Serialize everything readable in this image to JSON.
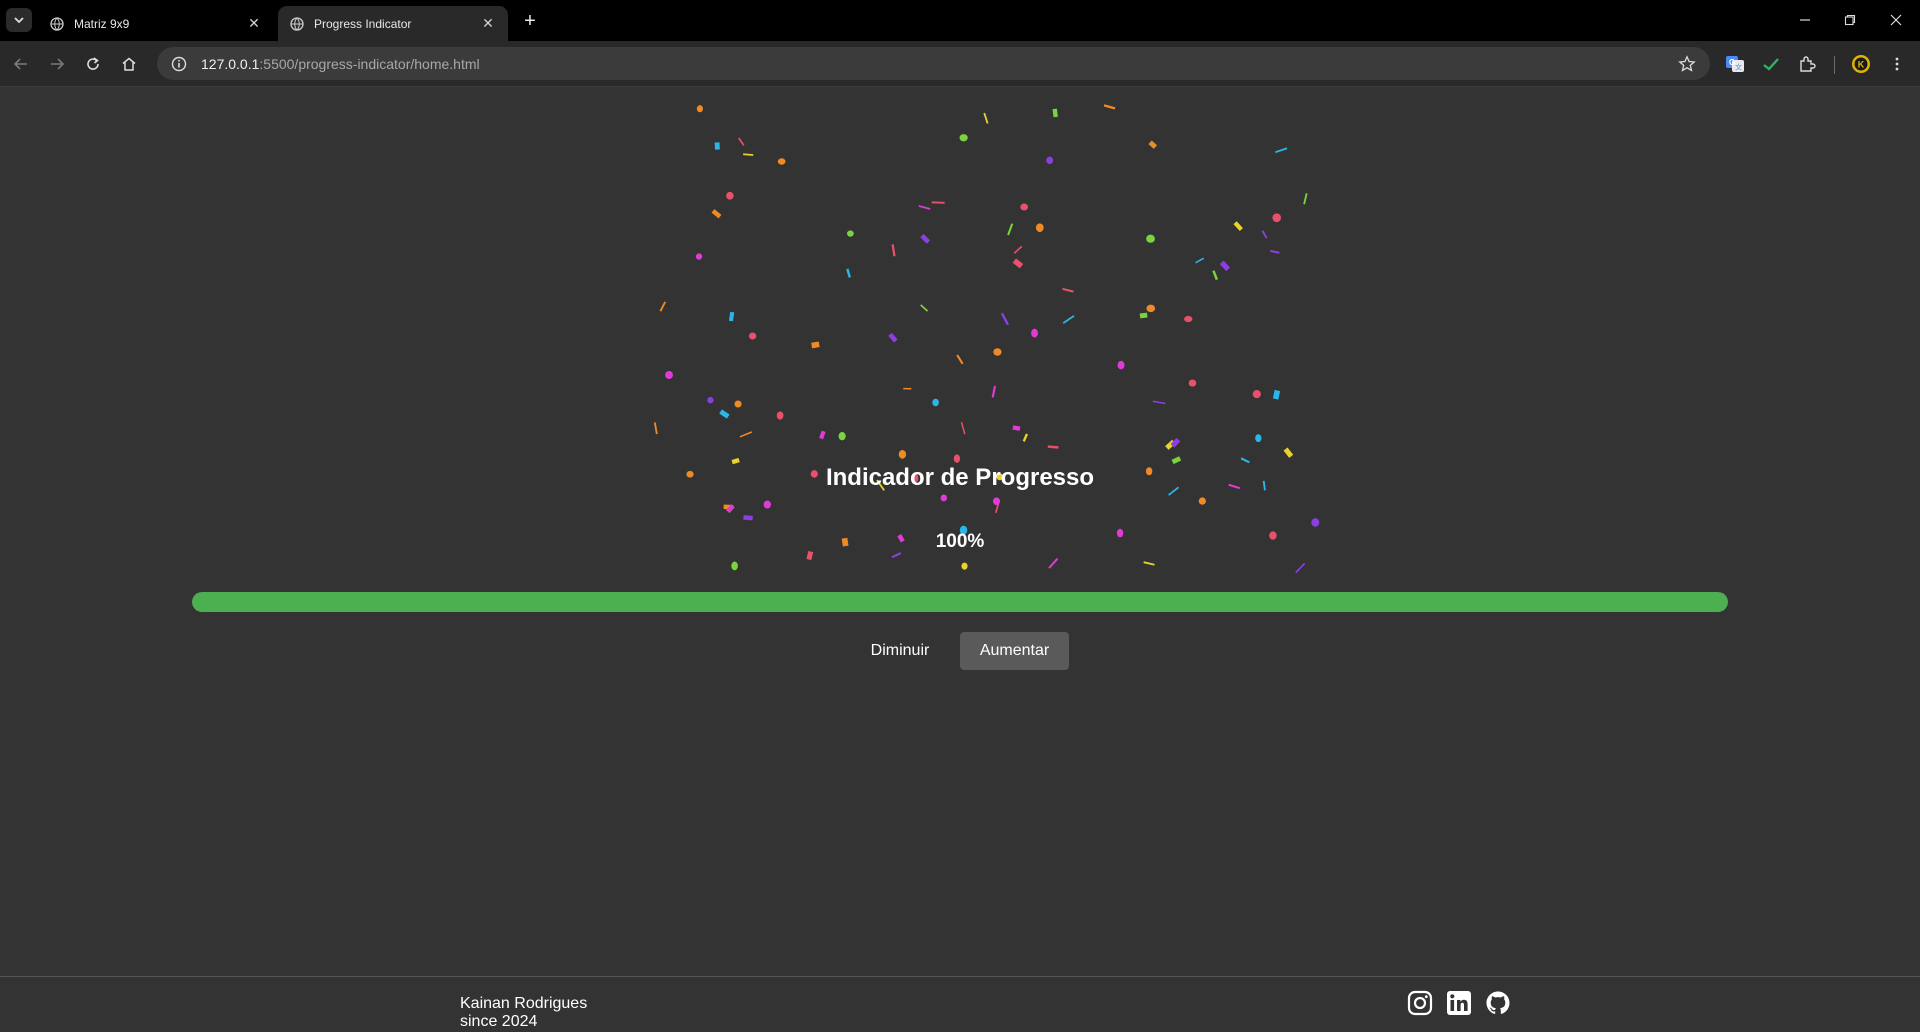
{
  "browser": {
    "tabs": [
      {
        "title": "Matriz 9x9",
        "active": false
      },
      {
        "title": "Progress Indicator",
        "active": true
      }
    ],
    "url_host": "127.0.0.1",
    "url_path": ":5500/progress-indicator/home.html"
  },
  "main": {
    "heading": "Indicador de Progresso",
    "percent_label": "100%",
    "progress": 1.0,
    "decrease_label": "Diminuir",
    "increase_label": "Aumentar"
  },
  "footer": {
    "author": "Kainan Rodrigues",
    "since": "since 2024",
    "social_icons": [
      "instagram-icon",
      "linkedin-icon",
      "github-icon"
    ]
  },
  "colors": {
    "background": "#333333",
    "progress_fill": "#4caf50",
    "confetti": [
      "#e8506c",
      "#8b3fe0",
      "#2bb5e8",
      "#e8d32b",
      "#7ad33f",
      "#f08a24",
      "#e03bd8"
    ]
  }
}
